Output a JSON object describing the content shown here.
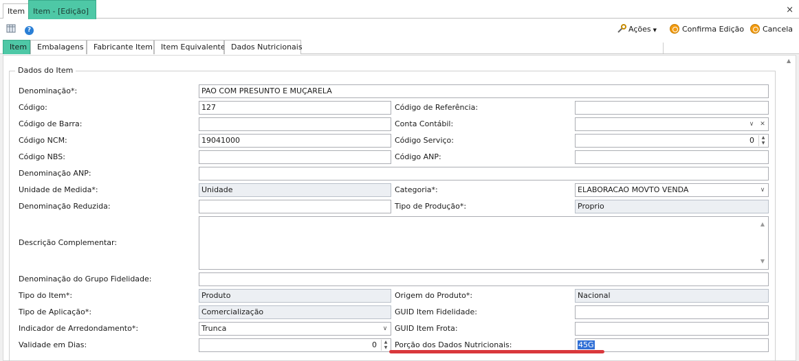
{
  "window": {
    "doc_tabs": [
      "Item",
      "Item - [Edição]"
    ],
    "close_glyph": "×"
  },
  "toolbar": {
    "actions_label": "Ações",
    "confirm_label": "Confirma Edição",
    "cancel_label": "Cancela",
    "help_glyph": "?"
  },
  "form_tabs": [
    "Item",
    "Embalagens",
    "Fabricante Item",
    "Item Equivalente",
    "Dados Nutricionais"
  ],
  "group": {
    "title": "Dados do Item"
  },
  "fields": {
    "denominacao": {
      "label": "Denominação*:",
      "value": "PAO COM PRESUNTO E MUÇARELA"
    },
    "codigo": {
      "label": "Código:",
      "value": "127"
    },
    "codigo_referencia": {
      "label": "Código de Referência:",
      "value": ""
    },
    "codigo_barra": {
      "label": "Código de Barra:",
      "value": ""
    },
    "conta_contabil": {
      "label": "Conta Contábil:",
      "value": ""
    },
    "codigo_ncm": {
      "label": "Código NCM:",
      "value": "19041000"
    },
    "codigo_servico": {
      "label": "Código Serviço:",
      "value": "0"
    },
    "codigo_nbs": {
      "label": "Código NBS:",
      "value": ""
    },
    "codigo_anp": {
      "label": "Código ANP:",
      "value": ""
    },
    "denominacao_anp": {
      "label": "Denominação ANP:",
      "value": ""
    },
    "unidade_medida": {
      "label": "Unidade de Medida*:",
      "value": "Unidade"
    },
    "categoria": {
      "label": "Categoria*:",
      "value": "ELABORACAO MOVTO VENDA"
    },
    "denominacao_reduzida": {
      "label": "Denominação Reduzida:",
      "value": ""
    },
    "tipo_producao": {
      "label": "Tipo de Produção*:",
      "value": "Proprio"
    },
    "descricao_complementar": {
      "label": "Descrição Complementar:",
      "value": ""
    },
    "grupo_fidelidade": {
      "label": "Denominação do Grupo Fidelidade:",
      "value": ""
    },
    "tipo_item": {
      "label": "Tipo do Item*:",
      "value": "Produto"
    },
    "origem_produto": {
      "label": "Origem do Produto*:",
      "value": "Nacional"
    },
    "tipo_aplicacao": {
      "label": "Tipo de Aplicação*:",
      "value": "Comercialização"
    },
    "guid_fidelidade": {
      "label": "GUID Item Fidelidade:",
      "value": ""
    },
    "indicador_arredondamento": {
      "label": "Indicador de Arredondamento*:",
      "value": "Trunca"
    },
    "guid_frota": {
      "label": "GUID Item Frota:",
      "value": ""
    },
    "validade_dias": {
      "label": "Validade em Dias:",
      "value": "0"
    },
    "porcao_nutricional": {
      "label": "Porção dos Dados Nutricionais:",
      "value": "45G"
    }
  },
  "colors": {
    "accent_tab": "#4ec8a6",
    "highlight_underline": "#d9383c",
    "selection": "#2f6fd6"
  }
}
